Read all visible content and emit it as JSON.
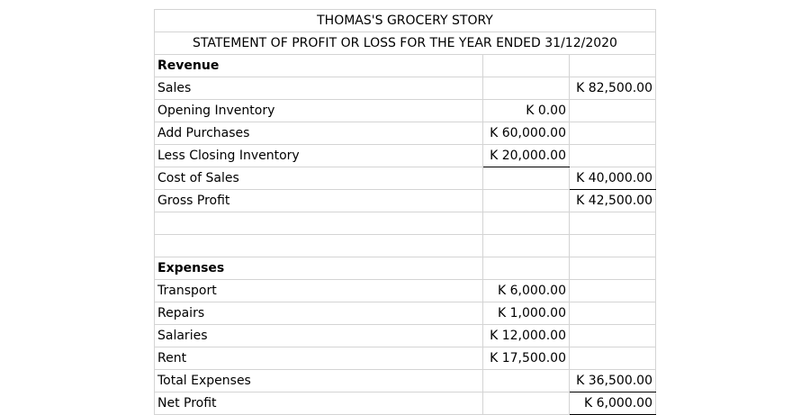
{
  "title": "THOMAS'S GROCERY STORY",
  "subtitle": "STATEMENT OF PROFIT OR LOSS FOR THE YEAR ENDED 31/12/2020",
  "rows": [
    {
      "label": "Revenue",
      "mid": "",
      "right": ""
    },
    {
      "label": "Sales",
      "mid": "",
      "right": "K 82,500.00"
    },
    {
      "label": "Opening Inventory",
      "mid": "K 0.00",
      "right": ""
    },
    {
      "label": "Add Purchases",
      "mid": "K 60,000.00",
      "right": ""
    },
    {
      "label": "Less Closing Inventory",
      "mid": "K 20,000.00",
      "right": ""
    },
    {
      "label": "Cost of Sales",
      "mid": "",
      "right": "K 40,000.00"
    },
    {
      "label": "Gross Profit",
      "mid": "",
      "right": "K 42,500.00"
    },
    {
      "label": "",
      "mid": "",
      "right": ""
    },
    {
      "label": "",
      "mid": "",
      "right": ""
    },
    {
      "label": "Expenses",
      "mid": "",
      "right": ""
    },
    {
      "label": "Transport",
      "mid": "K 6,000.00",
      "right": ""
    },
    {
      "label": "Repairs",
      "mid": "K 1,000.00",
      "right": ""
    },
    {
      "label": "Salaries",
      "mid": "K 12,000.00",
      "right": ""
    },
    {
      "label": "Rent",
      "mid": "K 17,500.00",
      "right": ""
    },
    {
      "label": "Total Expenses",
      "mid": "",
      "right": "K 36,500.00"
    },
    {
      "label": "Net Profit",
      "mid": "",
      "right": "K 6,000.00"
    }
  ]
}
